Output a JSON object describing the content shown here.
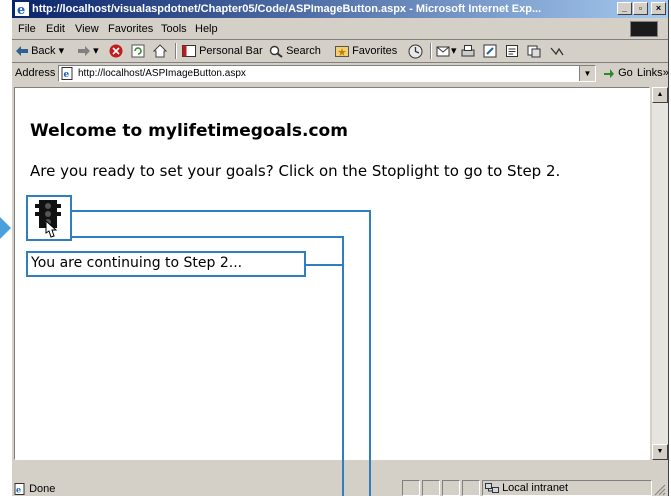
{
  "window": {
    "title": "http://localhost/visualaspdotnet/Chapter05/Code/ASPImageButton.aspx - Microsoft Internet Exp...",
    "minimize_glyph": "_",
    "maximize_glyph": "▫",
    "close_glyph": "×"
  },
  "menu": [
    "File",
    "Edit",
    "View",
    "Favorites",
    "Tools",
    "Help"
  ],
  "toolbar": {
    "back": "Back",
    "personal_bar": "Personal Bar",
    "search": "Search",
    "favorites": "Favorites"
  },
  "address": {
    "label": "Address",
    "url": "http://localhost/ASPImageButton.aspx",
    "go": "Go",
    "links": "Links"
  },
  "page": {
    "heading": "Welcome to mylifetimegoals.com",
    "prompt": "Are you ready to set your goals? Click on the Stoplight to go to Step 2.",
    "result_text": "You are continuing to Step 2..."
  },
  "status": {
    "text": "Done",
    "zone": "Local intranet"
  },
  "colors": {
    "callout": "#2f7fbf",
    "arrow": "#4aa0dc",
    "titlebar": "#0a246a"
  }
}
